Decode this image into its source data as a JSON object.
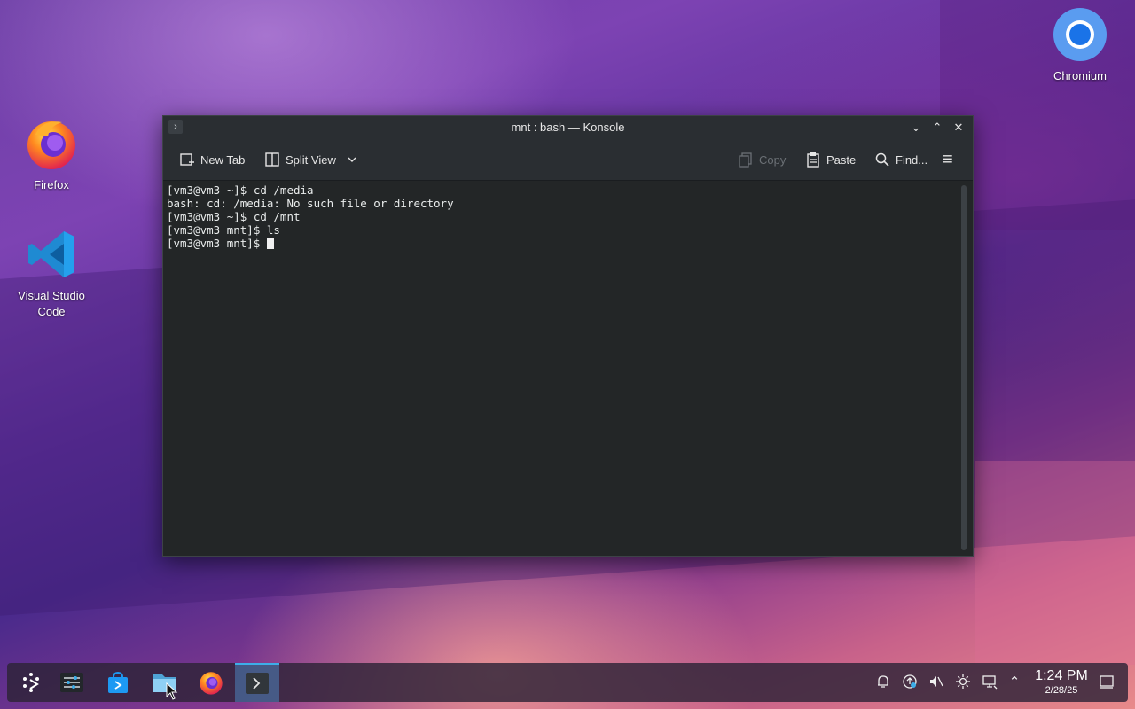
{
  "desktop": {
    "icons": [
      {
        "label": "Firefox",
        "icon": "firefox-icon"
      },
      {
        "label": "Visual Studio Code",
        "icon": "vscode-icon"
      },
      {
        "label": "Chromium",
        "icon": "chromium-icon"
      }
    ]
  },
  "window": {
    "title": "mnt : bash — Konsole",
    "menu_glyph": "›",
    "controls": {
      "minimize": "⌄",
      "maximize": "⌃",
      "close": "✕"
    },
    "toolbar": {
      "new_tab": "New Tab",
      "split_view": "Split View",
      "copy": "Copy",
      "paste": "Paste",
      "find": "Find...",
      "menu_glyph": "≡"
    },
    "terminal": {
      "lines": [
        "[vm3@vm3 ~]$ cd /media",
        "bash: cd: /media: No such file or directory",
        "[vm3@vm3 ~]$ cd /mnt",
        "[vm3@vm3 mnt]$ ls",
        "[vm3@vm3 mnt]$ "
      ]
    }
  },
  "taskbar": {
    "items": [
      {
        "name": "application-launcher",
        "icon": "launcher-icon"
      },
      {
        "name": "system-settings",
        "icon": "settings-icon"
      },
      {
        "name": "discover",
        "icon": "store-icon"
      },
      {
        "name": "dolphin",
        "icon": "folder-icon"
      },
      {
        "name": "firefox",
        "icon": "firefox-icon"
      },
      {
        "name": "konsole",
        "icon": "terminal-icon",
        "active": true
      }
    ],
    "tray": {
      "notifications": "notification-bell-icon",
      "updates": "update-icon",
      "volume": "volume-muted-icon",
      "brightness": "brightness-icon",
      "network": "network-icon",
      "expand": "⌃"
    },
    "clock": {
      "time": "1:24 PM",
      "date": "2/28/25"
    }
  },
  "colors": {
    "accent": "#3daee9",
    "window_bg": "#2a2e32",
    "terminal_bg": "#232627",
    "terminal_fg": "#e9ecec"
  }
}
